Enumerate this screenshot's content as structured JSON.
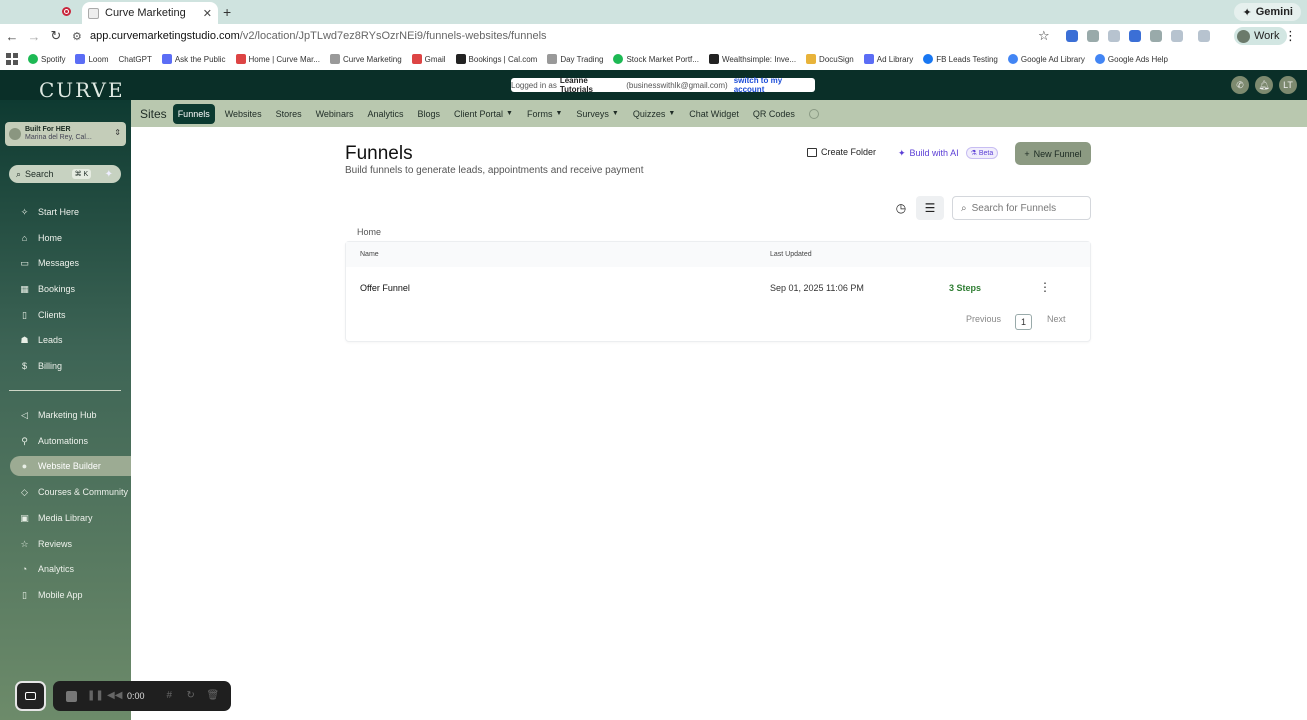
{
  "browser": {
    "tab_title": "Curve Marketing",
    "new_tab": "+",
    "gemini_label": "Gemini",
    "url_host": "app.curvemarketingstudio.com",
    "url_path": "/v2/location/JpTLwd7ez8RYsOzrNEi9/funnels-websites/funnels",
    "profile_label": "Work",
    "bookmarks": [
      "Spotify",
      "Loom",
      "ChatGPT",
      "Ask the Public",
      "Home | Curve Mar...",
      "Curve Marketing",
      "Gmail",
      "Bookings | Cal.com",
      "Day Trading",
      "Stock Market Portf...",
      "Wealthsimple: Inve...",
      "DocuSign",
      "Ad Library",
      "FB Leads Testing",
      "Google Ad Library",
      "Google Ads Help"
    ]
  },
  "app": {
    "logo": "CURVE",
    "login_banner": {
      "prefix": "Logged in as",
      "user": "Leanne Tutorials",
      "email": "(businesswithlk@gmail.com)",
      "switch_label": "switch to my account"
    },
    "avatar_initials": "LT",
    "account": {
      "name": "Built For HER",
      "location": "Marina del Rey, Cal..."
    },
    "search": {
      "label": "Search",
      "shortcut": "⌘ K"
    },
    "sidebar": [
      {
        "label": "Start Here",
        "icon": "sparkle-icon"
      },
      {
        "label": "Home",
        "icon": "home-icon"
      },
      {
        "label": "Messages",
        "icon": "chat-icon"
      },
      {
        "label": "Bookings",
        "icon": "calendar-icon"
      },
      {
        "label": "Clients",
        "icon": "clipboard-icon"
      },
      {
        "label": "Leads",
        "icon": "users-icon"
      },
      {
        "label": "Billing",
        "icon": "dollar-icon"
      },
      {
        "label": "Marketing Hub",
        "icon": "megaphone-icon"
      },
      {
        "label": "Automations",
        "icon": "workflow-icon"
      },
      {
        "label": "Website Builder",
        "icon": "globe-icon"
      },
      {
        "label": "Courses & Community",
        "icon": "graduation-icon"
      },
      {
        "label": "Media Library",
        "icon": "image-icon"
      },
      {
        "label": "Reviews",
        "icon": "star-icon"
      },
      {
        "label": "Analytics",
        "icon": "chart-icon"
      },
      {
        "label": "Mobile App",
        "icon": "mobile-icon"
      }
    ],
    "subnav": {
      "section": "Sites",
      "items": [
        "Funnels",
        "Websites",
        "Stores",
        "Webinars",
        "Analytics",
        "Blogs",
        "Client Portal",
        "Forms",
        "Surveys",
        "Quizzes",
        "Chat Widget",
        "QR Codes"
      ]
    }
  },
  "page": {
    "title": "Funnels",
    "subtitle": "Build funnels to generate leads, appointments and receive payment",
    "create_folder": "Create Folder",
    "build_ai": "Build with AI",
    "beta": "Beta",
    "new_funnel": "New Funnel",
    "search_placeholder": "Search for Funnels",
    "breadcrumb": "Home",
    "columns": {
      "name": "Name",
      "updated": "Last Updated"
    },
    "rows": [
      {
        "name": "Offer Funnel",
        "updated": "Sep 01, 2025 11:06 PM",
        "steps": "3 Steps"
      }
    ],
    "pagination": {
      "prev": "Previous",
      "page": "1",
      "next": "Next"
    }
  },
  "recorder": {
    "time": "0:00"
  },
  "colors": {
    "sidebar_dark": "#0e3a31",
    "subnav": "#b9c8af",
    "accent_green": "#2e7d32",
    "ai_purple": "#5b3ed6"
  }
}
